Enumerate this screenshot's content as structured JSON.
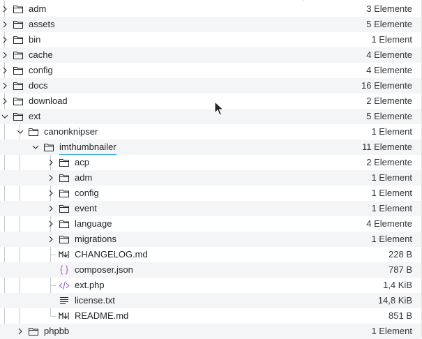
{
  "colors": {
    "accent": "#3daee9",
    "folder_icon": "#232629",
    "row_alt": "#f4f5f6",
    "json_icon": "#b04fd0",
    "php_icon": "#8a5fc8"
  },
  "rows": [
    {
      "name": "adm",
      "size": "3 Elemente",
      "icon": "folder-icon",
      "expander": "collapsed"
    },
    {
      "name": "assets",
      "size": "5 Elemente",
      "icon": "folder-icon",
      "expander": "collapsed"
    },
    {
      "name": "bin",
      "size": "1 Element",
      "icon": "folder-icon",
      "expander": "collapsed"
    },
    {
      "name": "cache",
      "size": "4 Elemente",
      "icon": "folder-icon",
      "expander": "collapsed"
    },
    {
      "name": "config",
      "size": "4 Elemente",
      "icon": "folder-icon",
      "expander": "collapsed"
    },
    {
      "name": "docs",
      "size": "16 Elemente",
      "icon": "folder-icon",
      "expander": "collapsed"
    },
    {
      "name": "download",
      "size": "2 Elemente",
      "icon": "folder-icon",
      "expander": "collapsed"
    },
    {
      "name": "ext",
      "size": "5 Elemente",
      "icon": "folder-icon",
      "expander": "expanded"
    },
    {
      "name": "canonknipser",
      "size": "1 Element",
      "icon": "folder-icon",
      "expander": "expanded"
    },
    {
      "name": "imthumbnailer",
      "size": "11 Elemente",
      "icon": "folder-icon",
      "expander": "expanded"
    },
    {
      "name": "acp",
      "size": "2 Elemente",
      "icon": "folder-icon",
      "expander": "collapsed"
    },
    {
      "name": "adm",
      "size": "1 Element",
      "icon": "folder-icon",
      "expander": "collapsed"
    },
    {
      "name": "config",
      "size": "1 Element",
      "icon": "folder-icon",
      "expander": "collapsed"
    },
    {
      "name": "event",
      "size": "1 Element",
      "icon": "folder-icon",
      "expander": "collapsed"
    },
    {
      "name": "language",
      "size": "4 Elemente",
      "icon": "folder-icon",
      "expander": "collapsed"
    },
    {
      "name": "migrations",
      "size": "1 Element",
      "icon": "folder-icon",
      "expander": "collapsed"
    },
    {
      "name": "CHANGELOG.md",
      "size": "228 B",
      "icon": "markdown-icon",
      "expander": "none"
    },
    {
      "name": "composer.json",
      "size": "787 B",
      "icon": "json-icon",
      "expander": "none"
    },
    {
      "name": "ext.php",
      "size": "1,4 KiB",
      "icon": "php-icon",
      "expander": "none"
    },
    {
      "name": "license.txt",
      "size": "14,8 KiB",
      "icon": "text-file-icon",
      "expander": "none"
    },
    {
      "name": "README.md",
      "size": "851 B",
      "icon": "markdown-icon",
      "expander": "none"
    },
    {
      "name": "phpbb",
      "size": "1 Element",
      "icon": "folder-icon",
      "expander": "collapsed"
    }
  ]
}
